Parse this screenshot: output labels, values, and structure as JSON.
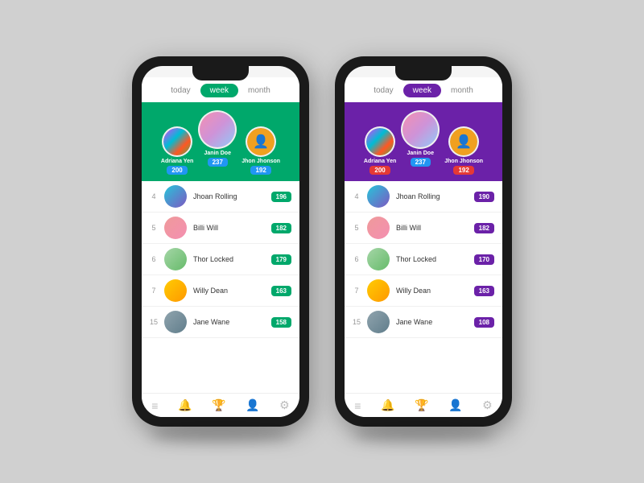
{
  "phones": [
    {
      "id": "green-phone",
      "theme": "green",
      "tabs": [
        "today",
        "week",
        "month"
      ],
      "active_tab": "week",
      "leaders": [
        {
          "rank": 2,
          "name": "Adriana Yen",
          "score": "200",
          "score_color": "blue",
          "avatar": "av-1",
          "size": "normal"
        },
        {
          "rank": 1,
          "name": "Janin Doe",
          "score": "237",
          "score_color": "blue",
          "avatar": "av-2",
          "size": "large"
        },
        {
          "rank": 3,
          "name": "Jhon Jhonson",
          "score": "192",
          "score_color": "blue",
          "avatar": "av-3",
          "size": "normal"
        }
      ],
      "list": [
        {
          "rank": "4",
          "name": "Jhoan Rolling",
          "score": "196",
          "avatar": "av-4"
        },
        {
          "rank": "5",
          "name": "Billi Will",
          "score": "182",
          "avatar": "av-5"
        },
        {
          "rank": "6",
          "name": "Thor Locked",
          "score": "179",
          "avatar": "av-6"
        },
        {
          "rank": "7",
          "name": "Willy Dean",
          "score": "163",
          "avatar": "av-7"
        },
        {
          "rank": "15",
          "name": "Jane Wane",
          "score": "158",
          "avatar": "av-8"
        }
      ],
      "nav_icons": [
        "≡",
        "🔔",
        "🏆",
        "👤",
        "⚙"
      ]
    },
    {
      "id": "purple-phone",
      "theme": "purple",
      "tabs": [
        "today",
        "week",
        "month"
      ],
      "active_tab": "week",
      "leaders": [
        {
          "rank": 2,
          "name": "Adriana Yen",
          "score": "200",
          "score_color": "red",
          "avatar": "av-1",
          "size": "normal"
        },
        {
          "rank": 1,
          "name": "Janin Doe",
          "score": "237",
          "score_color": "blue",
          "avatar": "av-2",
          "size": "large"
        },
        {
          "rank": 3,
          "name": "Jhon Jhonson",
          "score": "192",
          "score_color": "red",
          "avatar": "av-3",
          "size": "normal"
        }
      ],
      "list": [
        {
          "rank": "4",
          "name": "Jhoan Rolling",
          "score": "190",
          "avatar": "av-4"
        },
        {
          "rank": "5",
          "name": "Billi Will",
          "score": "182",
          "avatar": "av-5"
        },
        {
          "rank": "6",
          "name": "Thor Locked",
          "score": "170",
          "avatar": "av-6"
        },
        {
          "rank": "7",
          "name": "Willy Dean",
          "score": "163",
          "avatar": "av-7"
        },
        {
          "rank": "15",
          "name": "Jane Wane",
          "score": "108",
          "avatar": "av-8"
        }
      ],
      "nav_icons": [
        "≡",
        "🔔",
        "🏆",
        "👤",
        "⚙"
      ]
    }
  ]
}
